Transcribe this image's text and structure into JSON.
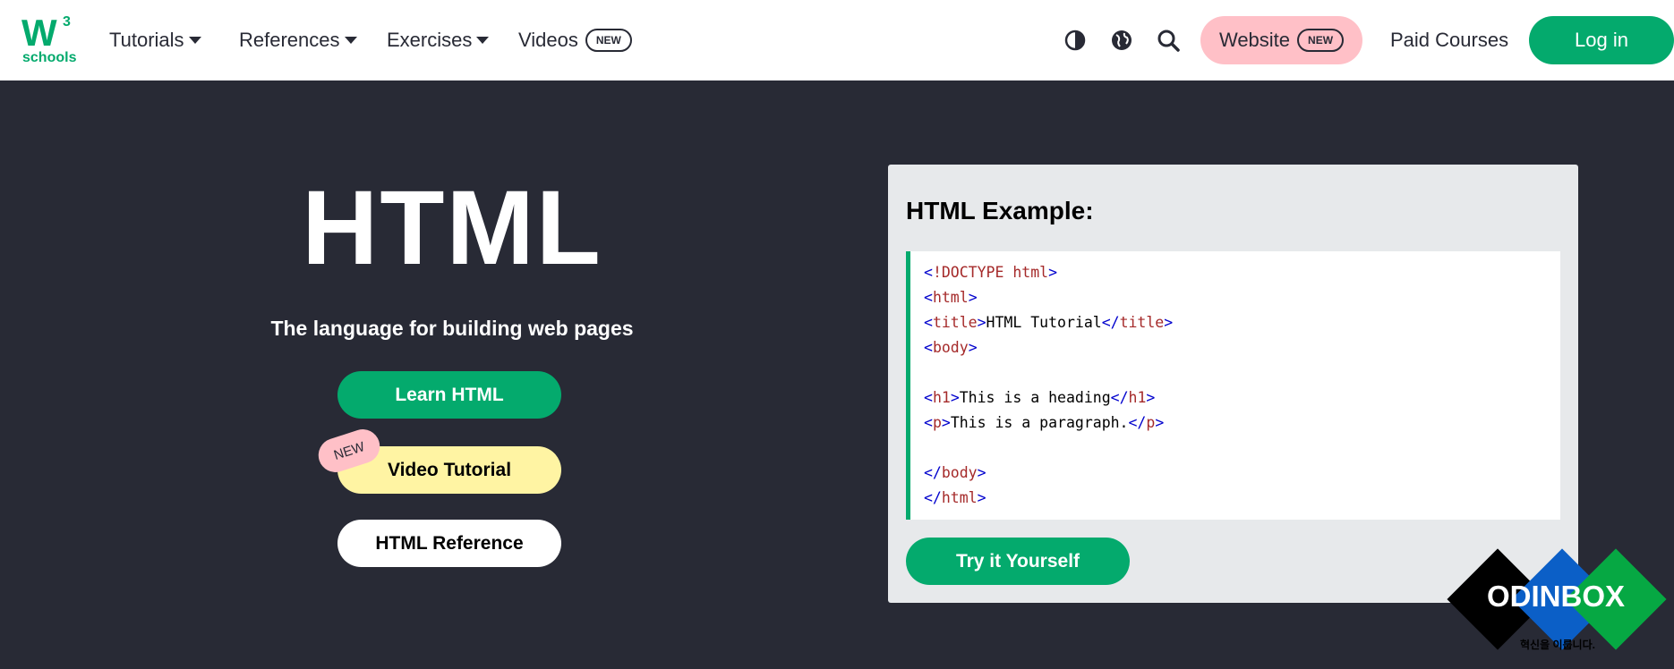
{
  "brand": {
    "logo_w": "W",
    "logo_3": "3",
    "logo_schools": "schools",
    "color": "#04aa6d"
  },
  "nav": {
    "tutorials": "Tutorials",
    "references": "References",
    "exercises": "Exercises",
    "videos": "Videos",
    "videos_badge": "NEW",
    "website": "Website",
    "website_badge": "NEW",
    "paid_courses": "Paid Courses",
    "login": "Log in"
  },
  "icons": [
    "contrast-icon",
    "globe-icon",
    "search-icon"
  ],
  "hero": {
    "title": "HTML",
    "subtitle": "The language for building web pages",
    "learn_label": "Learn HTML",
    "video_label": "Video Tutorial",
    "video_tag": "NEW",
    "reference_label": "HTML Reference"
  },
  "example": {
    "title": "HTML Example:",
    "code": {
      "doctype_open": "<",
      "doctype": "!DOCTYPE html",
      "doctype_close": ">",
      "html_open": "html",
      "title_tag": "title",
      "title_text": "HTML Tutorial",
      "body_tag": "body",
      "h1_tag": "h1",
      "h1_text": "This is a heading",
      "p_tag": "p",
      "p_text": "This is a paragraph."
    },
    "try_label": "Try it Yourself"
  },
  "watermark": {
    "text": "ODINBOX",
    "sub": "혁신을 이룹니다."
  },
  "colors": {
    "nav_bg": "#ffffff",
    "page_bg": "#282a35",
    "green": "#04aa6d",
    "pink": "#ffc0c7",
    "yellow": "#fff4a3",
    "panel": "#e7e9eb"
  }
}
